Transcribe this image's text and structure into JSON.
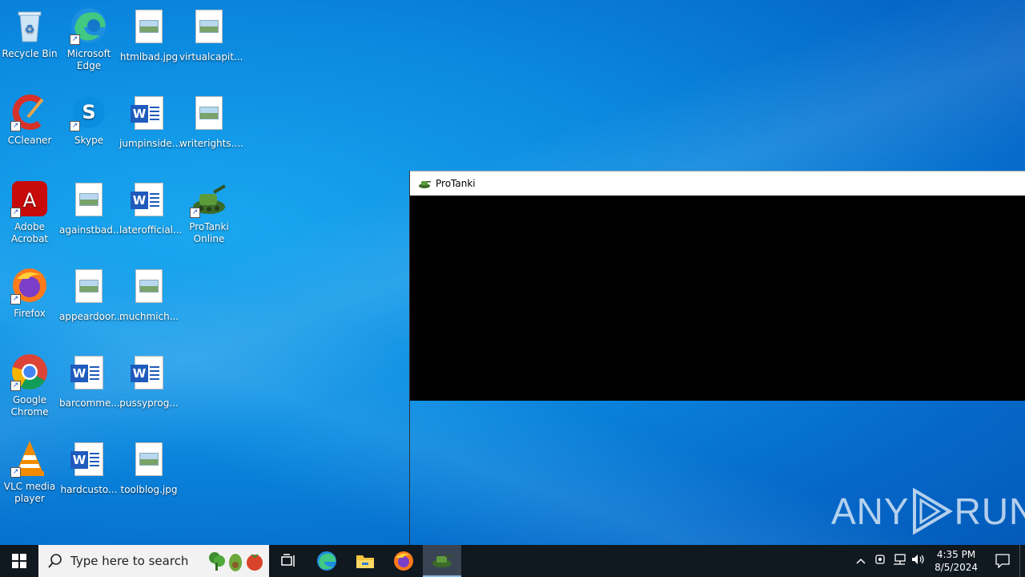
{
  "desktop": {
    "icons": [
      {
        "label": "Recycle Bin"
      },
      {
        "label": "Microsoft Edge"
      },
      {
        "label": "htmlbad.jpg"
      },
      {
        "label": "virtualcapit..."
      },
      {
        "label": "CCleaner"
      },
      {
        "label": "Skype"
      },
      {
        "label": "jumpinside..."
      },
      {
        "label": "writerights...."
      },
      {
        "label": "Adobe Acrobat"
      },
      {
        "label": "againstbad..."
      },
      {
        "label": "laterofficial..."
      },
      {
        "label": "ProTanki Online"
      },
      {
        "label": "Firefox"
      },
      {
        "label": "appeardoor..."
      },
      {
        "label": "muchmich..."
      },
      {
        "label": "Google Chrome"
      },
      {
        "label": "barcomme..."
      },
      {
        "label": "pussyprog..."
      },
      {
        "label": "VLC media player"
      },
      {
        "label": "hardcusto..."
      },
      {
        "label": "toolblog.jpg"
      }
    ]
  },
  "window": {
    "title": "ProTanki"
  },
  "watermark": {
    "left": "ANY",
    "right": "RUN"
  },
  "taskbar": {
    "search_placeholder": "Type here to search",
    "clock_time": "4:35 PM",
    "clock_date": "8/5/2024"
  },
  "colors": {
    "taskbar": "#101820",
    "window_content": "#000000",
    "desktop_accent": "#0b8ae0"
  }
}
